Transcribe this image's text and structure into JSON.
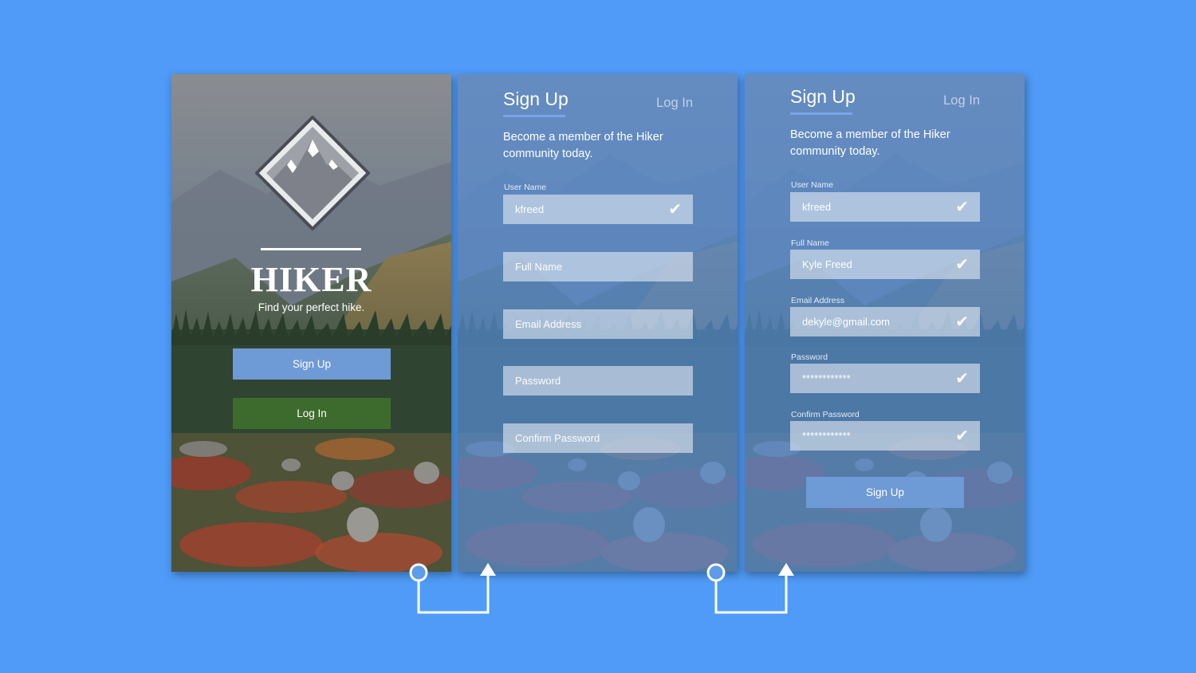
{
  "welcome": {
    "title": "HIKER",
    "tagline": "Find your perfect hike.",
    "signup_label": "Sign Up",
    "login_label": "Log In"
  },
  "signup_empty": {
    "tab_signup": "Sign Up",
    "tab_login": "Log In",
    "intro": "Become a member of the Hiker community today.",
    "username_label": "User Name",
    "username_value": "kfreed",
    "fullname_placeholder": "Full Name",
    "email_placeholder": "Email Address",
    "password_placeholder": "Password",
    "confirm_placeholder": "Confirm Password",
    "check": "✔"
  },
  "signup_filled": {
    "tab_signup": "Sign Up",
    "tab_login": "Log In",
    "intro": "Become a member of the Hiker community today.",
    "username_label": "User Name",
    "username_value": "kfreed",
    "fullname_label": "Full Name",
    "fullname_value": "Kyle Freed",
    "email_label": "Email Address",
    "email_value": "dekyle@gmail.com",
    "password_label": "Password",
    "password_value": "************",
    "confirm_label": "Confirm Password",
    "confirm_value": "************",
    "check": "✔",
    "submit_label": "Sign Up"
  },
  "colors": {
    "background": "#4f9bf7",
    "signup_button": "#6e9ad6",
    "login_button": "#3d6b2d",
    "tab_underline": "#7ba6e6"
  }
}
